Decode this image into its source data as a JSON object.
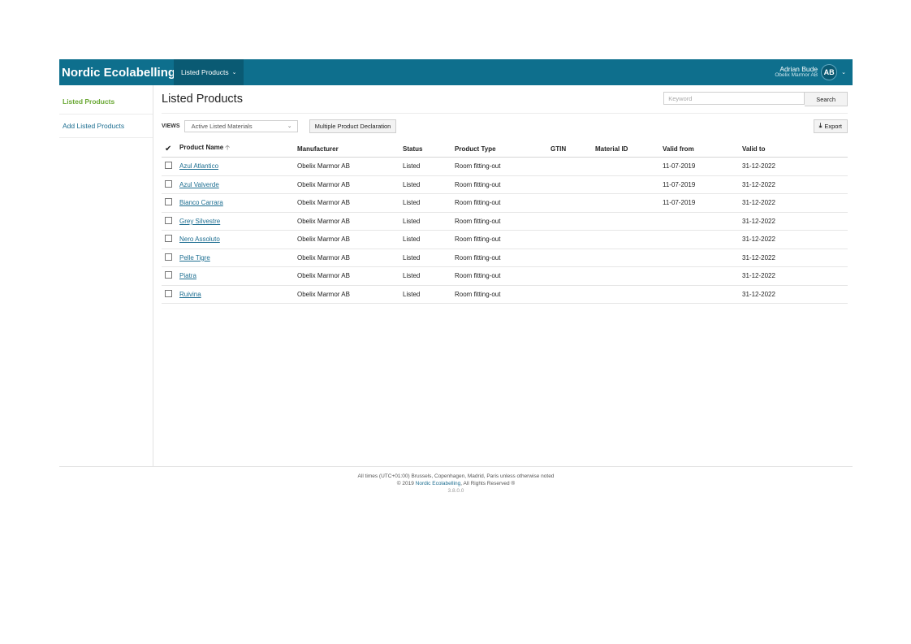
{
  "header": {
    "brand": "Nordic Ecolabelling",
    "nav_label": "Listed Products",
    "user_name": "Adrian Bude",
    "user_org": "Obelix Marmor AB",
    "avatar_initials": "AB",
    "color": "#0e6f8d"
  },
  "sidebar": {
    "items": [
      {
        "label": "Listed Products",
        "active": true
      },
      {
        "label": "Add Listed Products",
        "active": false
      }
    ]
  },
  "main": {
    "title": "Listed Products",
    "search": {
      "placeholder": "Keyword",
      "button_label": "Search"
    },
    "views_label": "VIEWS",
    "views_selected": "Active Listed Materials",
    "multiple_declaration_label": "Multiple Product Declaration",
    "export_label": "Export"
  },
  "table": {
    "columns": [
      "Product Name",
      "Manufacturer",
      "Status",
      "Product Type",
      "GTIN",
      "Material ID",
      "Valid from",
      "Valid to"
    ],
    "rows": [
      {
        "name": "Azul Atlantico",
        "manufacturer": "Obelix Marmor AB",
        "status": "Listed",
        "type": "Room fitting-out",
        "gtin": "",
        "material_id": "",
        "valid_from": "11-07-2019",
        "valid_to": "31-12-2022"
      },
      {
        "name": "Azul Valverde",
        "manufacturer": "Obelix Marmor AB",
        "status": "Listed",
        "type": "Room fitting-out",
        "gtin": "",
        "material_id": "",
        "valid_from": "11-07-2019",
        "valid_to": "31-12-2022"
      },
      {
        "name": "Bianco Carrara",
        "manufacturer": "Obelix Marmor AB",
        "status": "Listed",
        "type": "Room fitting-out",
        "gtin": "",
        "material_id": "",
        "valid_from": "11-07-2019",
        "valid_to": "31-12-2022"
      },
      {
        "name": "Grey Silvestre",
        "manufacturer": "Obelix Marmor AB",
        "status": "Listed",
        "type": "Room fitting-out",
        "gtin": "",
        "material_id": "",
        "valid_from": "",
        "valid_to": "31-12-2022"
      },
      {
        "name": "Nero Assoluto",
        "manufacturer": "Obelix Marmor AB",
        "status": "Listed",
        "type": "Room fitting-out",
        "gtin": "",
        "material_id": "",
        "valid_from": "",
        "valid_to": "31-12-2022"
      },
      {
        "name": "Pelle Tigre",
        "manufacturer": "Obelix Marmor AB",
        "status": "Listed",
        "type": "Room fitting-out",
        "gtin": "",
        "material_id": "",
        "valid_from": "",
        "valid_to": "31-12-2022"
      },
      {
        "name": "Piatra",
        "manufacturer": "Obelix Marmor AB",
        "status": "Listed",
        "type": "Room fitting-out",
        "gtin": "",
        "material_id": "",
        "valid_from": "",
        "valid_to": "31-12-2022"
      },
      {
        "name": "Ruivina",
        "manufacturer": "Obelix Marmor AB",
        "status": "Listed",
        "type": "Room fitting-out",
        "gtin": "",
        "material_id": "",
        "valid_from": "",
        "valid_to": "31-12-2022"
      }
    ]
  },
  "footer": {
    "timezone_note": "All times (UTC+01:00) Brussels, Copenhagen, Madrid, Paris unless otherwise noted",
    "copyright_prefix": "© 2019 ",
    "copyright_link": "Nordic Ecolabelling",
    "copyright_suffix": ", All Rights Reserved ®",
    "version": "3.8.0.0"
  }
}
